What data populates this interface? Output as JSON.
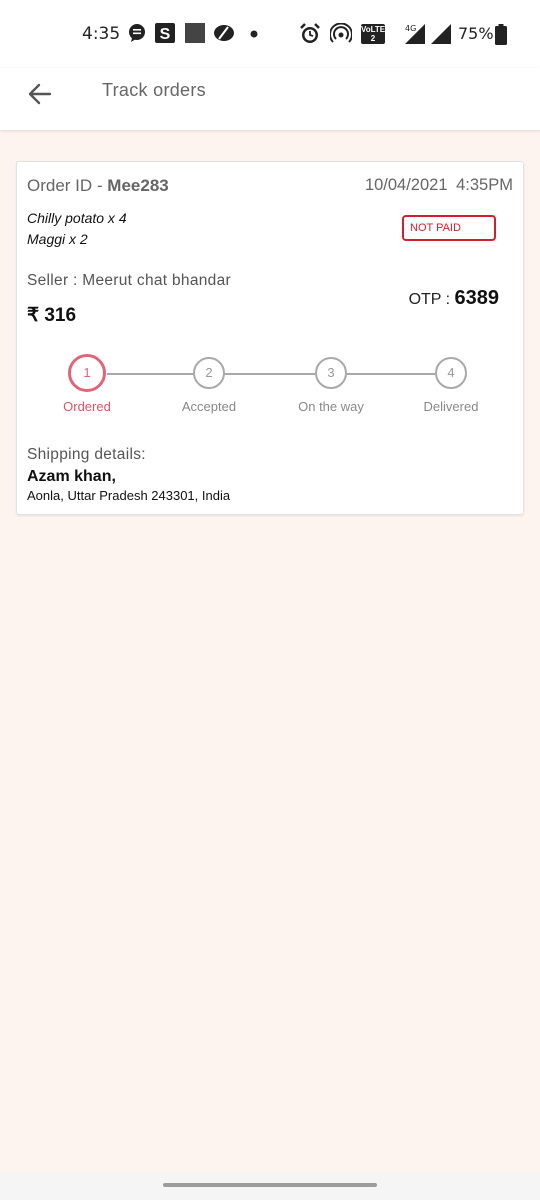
{
  "status_bar": {
    "time": "4:35",
    "battery": "75%",
    "network": "4G",
    "volte": "VoLTE 2",
    "icons": [
      "chat-icon",
      "s-app-icon",
      "square-app-icon",
      "leaf-app-icon",
      "dot-icon",
      "alarm-icon",
      "hotspot-icon",
      "volte-icon",
      "signal-4g-icon",
      "signal-icon",
      "battery-icon"
    ]
  },
  "app_bar": {
    "title": "Track orders",
    "back_icon": "arrow-left-icon"
  },
  "order": {
    "id_label": "Order ID - ",
    "id_value": "Mee283",
    "date": "10/04/2021",
    "time": "4:35PM",
    "items": [
      "Chilly potato x 4",
      "Maggi x 2"
    ],
    "payment_status": "NOT PAID",
    "seller": "Seller : Meerut chat bhandar",
    "otp_label": "OTP : ",
    "otp_value": "6389",
    "price": "₹ 316"
  },
  "progress": {
    "current_step": 1,
    "steps": [
      {
        "number": "1",
        "label": "Ordered"
      },
      {
        "number": "2",
        "label": "Accepted"
      },
      {
        "number": "3",
        "label": "On the way"
      },
      {
        "number": "4",
        "label": "Delivered"
      }
    ]
  },
  "shipping": {
    "heading": "Shipping details:",
    "name": "Azam khan,",
    "address": "Aonla, Uttar Pradesh 243301, India"
  },
  "colors": {
    "accent": "#e06578",
    "not_paid": "#d21f2c",
    "background": "#fdf4ef"
  }
}
